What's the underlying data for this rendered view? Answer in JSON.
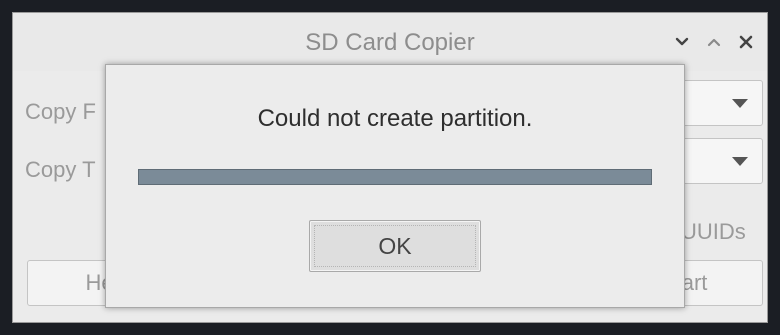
{
  "window": {
    "title": "SD Card Copier",
    "controls": {
      "minimize_icon": "chevron-down-icon",
      "maximize_icon": "chevron-up-icon",
      "close_icon": "close-icon"
    }
  },
  "form": {
    "copy_from_label": "Copy F",
    "copy_to_label": "Copy T",
    "uuids_label": "UUIDs"
  },
  "buttons": {
    "help_label": "Hel",
    "close_label": "",
    "start_label": "tart"
  },
  "dialog": {
    "message": "Could not create partition.",
    "progress_fraction": 1.0,
    "ok_label": "OK"
  },
  "colors": {
    "progress_fill": "#7b8b98",
    "progress_border": "#5f6c76",
    "backdrop": "#1b1e24"
  }
}
